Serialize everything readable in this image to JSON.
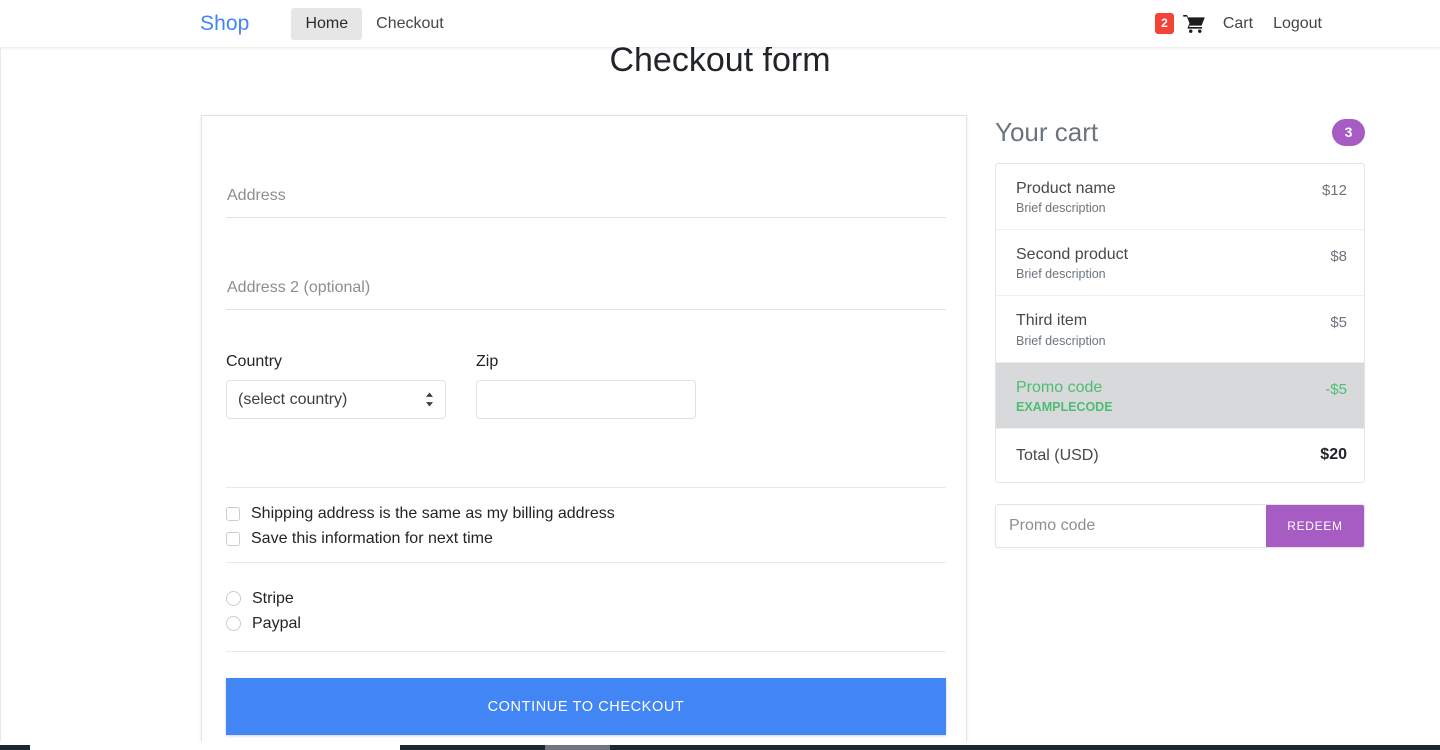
{
  "navbar": {
    "brand": "Shop",
    "links": [
      {
        "label": "Home",
        "active": true
      },
      {
        "label": "Checkout",
        "active": false
      }
    ],
    "cart_badge": "2",
    "cart_label": "Cart",
    "logout_label": "Logout",
    "cart_icon": "shopping-cart-icon",
    "badge_color": "#f44336",
    "brand_color": "#4285f4"
  },
  "page": {
    "heading": "Checkout form"
  },
  "form": {
    "address": {
      "placeholder": "Address",
      "value": ""
    },
    "address2": {
      "placeholder": "Address 2 (optional)",
      "value": ""
    },
    "country": {
      "label": "Country",
      "selected": "(select country)",
      "options": [
        "(select country)"
      ]
    },
    "zip": {
      "label": "Zip",
      "value": "",
      "placeholder": ""
    },
    "checkboxes": [
      {
        "label": "Shipping address is the same as my billing address",
        "checked": false
      },
      {
        "label": "Save this information for next time",
        "checked": false
      }
    ],
    "payment_methods": [
      {
        "label": "Stripe",
        "selected": false
      },
      {
        "label": "Paypal",
        "selected": false
      }
    ],
    "submit_label": "Continue to checkout",
    "submit_color": "#4285f4"
  },
  "cart": {
    "title": "Your cart",
    "count": "3",
    "count_color": "#a75cc4",
    "items": [
      {
        "name": "Product name",
        "desc": "Brief description",
        "price": "$12",
        "type": "item"
      },
      {
        "name": "Second product",
        "desc": "Brief description",
        "price": "$8",
        "type": "item"
      },
      {
        "name": "Third item",
        "desc": "Brief description",
        "price": "$5",
        "type": "item"
      },
      {
        "name": "Promo code",
        "desc": "EXAMPLECODE",
        "price": "-$5",
        "type": "promo"
      }
    ],
    "total": {
      "label": "Total (USD)",
      "value": "$20"
    },
    "promo_input_placeholder": "Promo code",
    "promo_input_value": "",
    "redeem_label": "Redeem",
    "redeem_color": "#a75cc4",
    "promo_text_color": "#4dbd74"
  }
}
